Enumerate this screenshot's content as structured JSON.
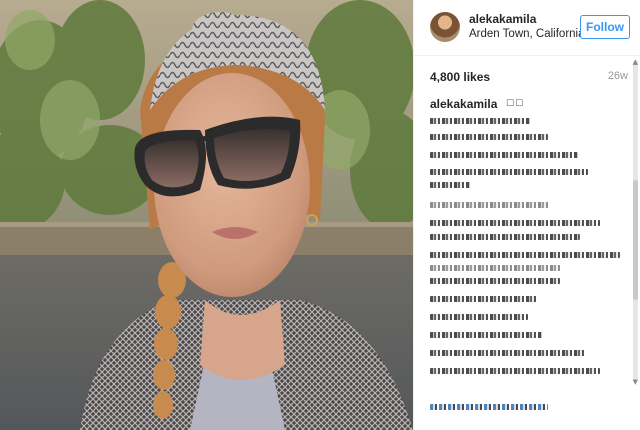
{
  "post": {
    "username": "alekakamila",
    "location": "Arden Town, California",
    "follow_label": "Follow",
    "likes": "4,800 likes",
    "time": "26w"
  },
  "caption": {
    "username": "alekakamila",
    "emoji": "☐☐"
  },
  "icons": {
    "avatar": "profile-avatar",
    "scroll_up": "scroll-up-arrow-icon",
    "scroll_down": "scroll-down-arrow-icon"
  },
  "colors": {
    "accent": "#3897f0",
    "text": "#262626",
    "muted": "#999999",
    "divider": "#efefef"
  }
}
